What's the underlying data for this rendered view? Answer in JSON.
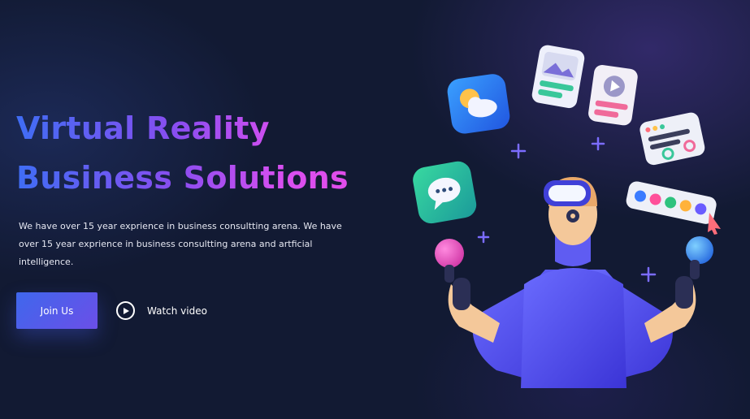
{
  "hero": {
    "title_line1": "Virtual Reality",
    "title_line2": "Business Solutions",
    "description": "We have over 15 year exprience in business consultting arena. We have over 15 year exprience in business consultting arena and artficial intelligence.",
    "join_label": "Join Us",
    "watch_label": "Watch video"
  },
  "colors": {
    "background": "#121a33",
    "gradient_start": "#3f6df4",
    "gradient_end": "#e34ce8",
    "button": "#4a5cec"
  },
  "icons": [
    "play-icon",
    "weather-icon",
    "chat-icon",
    "image-card-icon",
    "video-card-icon",
    "settings-card-icon",
    "color-palette-icon",
    "cursor-icon",
    "plus-icon",
    "vr-headset-icon"
  ]
}
